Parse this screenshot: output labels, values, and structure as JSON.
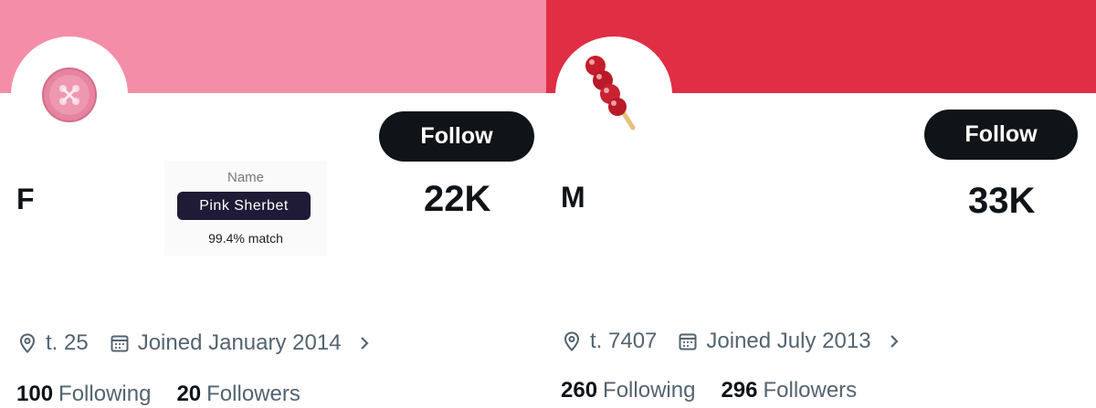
{
  "colors": {
    "panel1_banner": "#f48ea8",
    "panel2_banner": "#e02e44",
    "follow_button": "#0f1419"
  },
  "profiles": [
    {
      "avatar_icon": "pink-button-icon",
      "follow_label": "Follow",
      "initial": "F",
      "big_count": "22K",
      "tooltip": {
        "title": "Name",
        "value": "Pink Sherbet",
        "match": "99.4% match"
      },
      "location": "t. 25",
      "joined": "Joined January 2014",
      "following_count": "100",
      "following_label": "Following",
      "followers_count": "20",
      "followers_label": "Followers"
    },
    {
      "avatar_icon": "candied-fruit-skewer-icon",
      "follow_label": "Follow",
      "initial": "M",
      "big_count": "33K",
      "location": "t. 7407",
      "joined": "Joined July 2013",
      "following_count": "260",
      "following_label": "Following",
      "followers_count": "296",
      "followers_label": "Followers"
    }
  ]
}
